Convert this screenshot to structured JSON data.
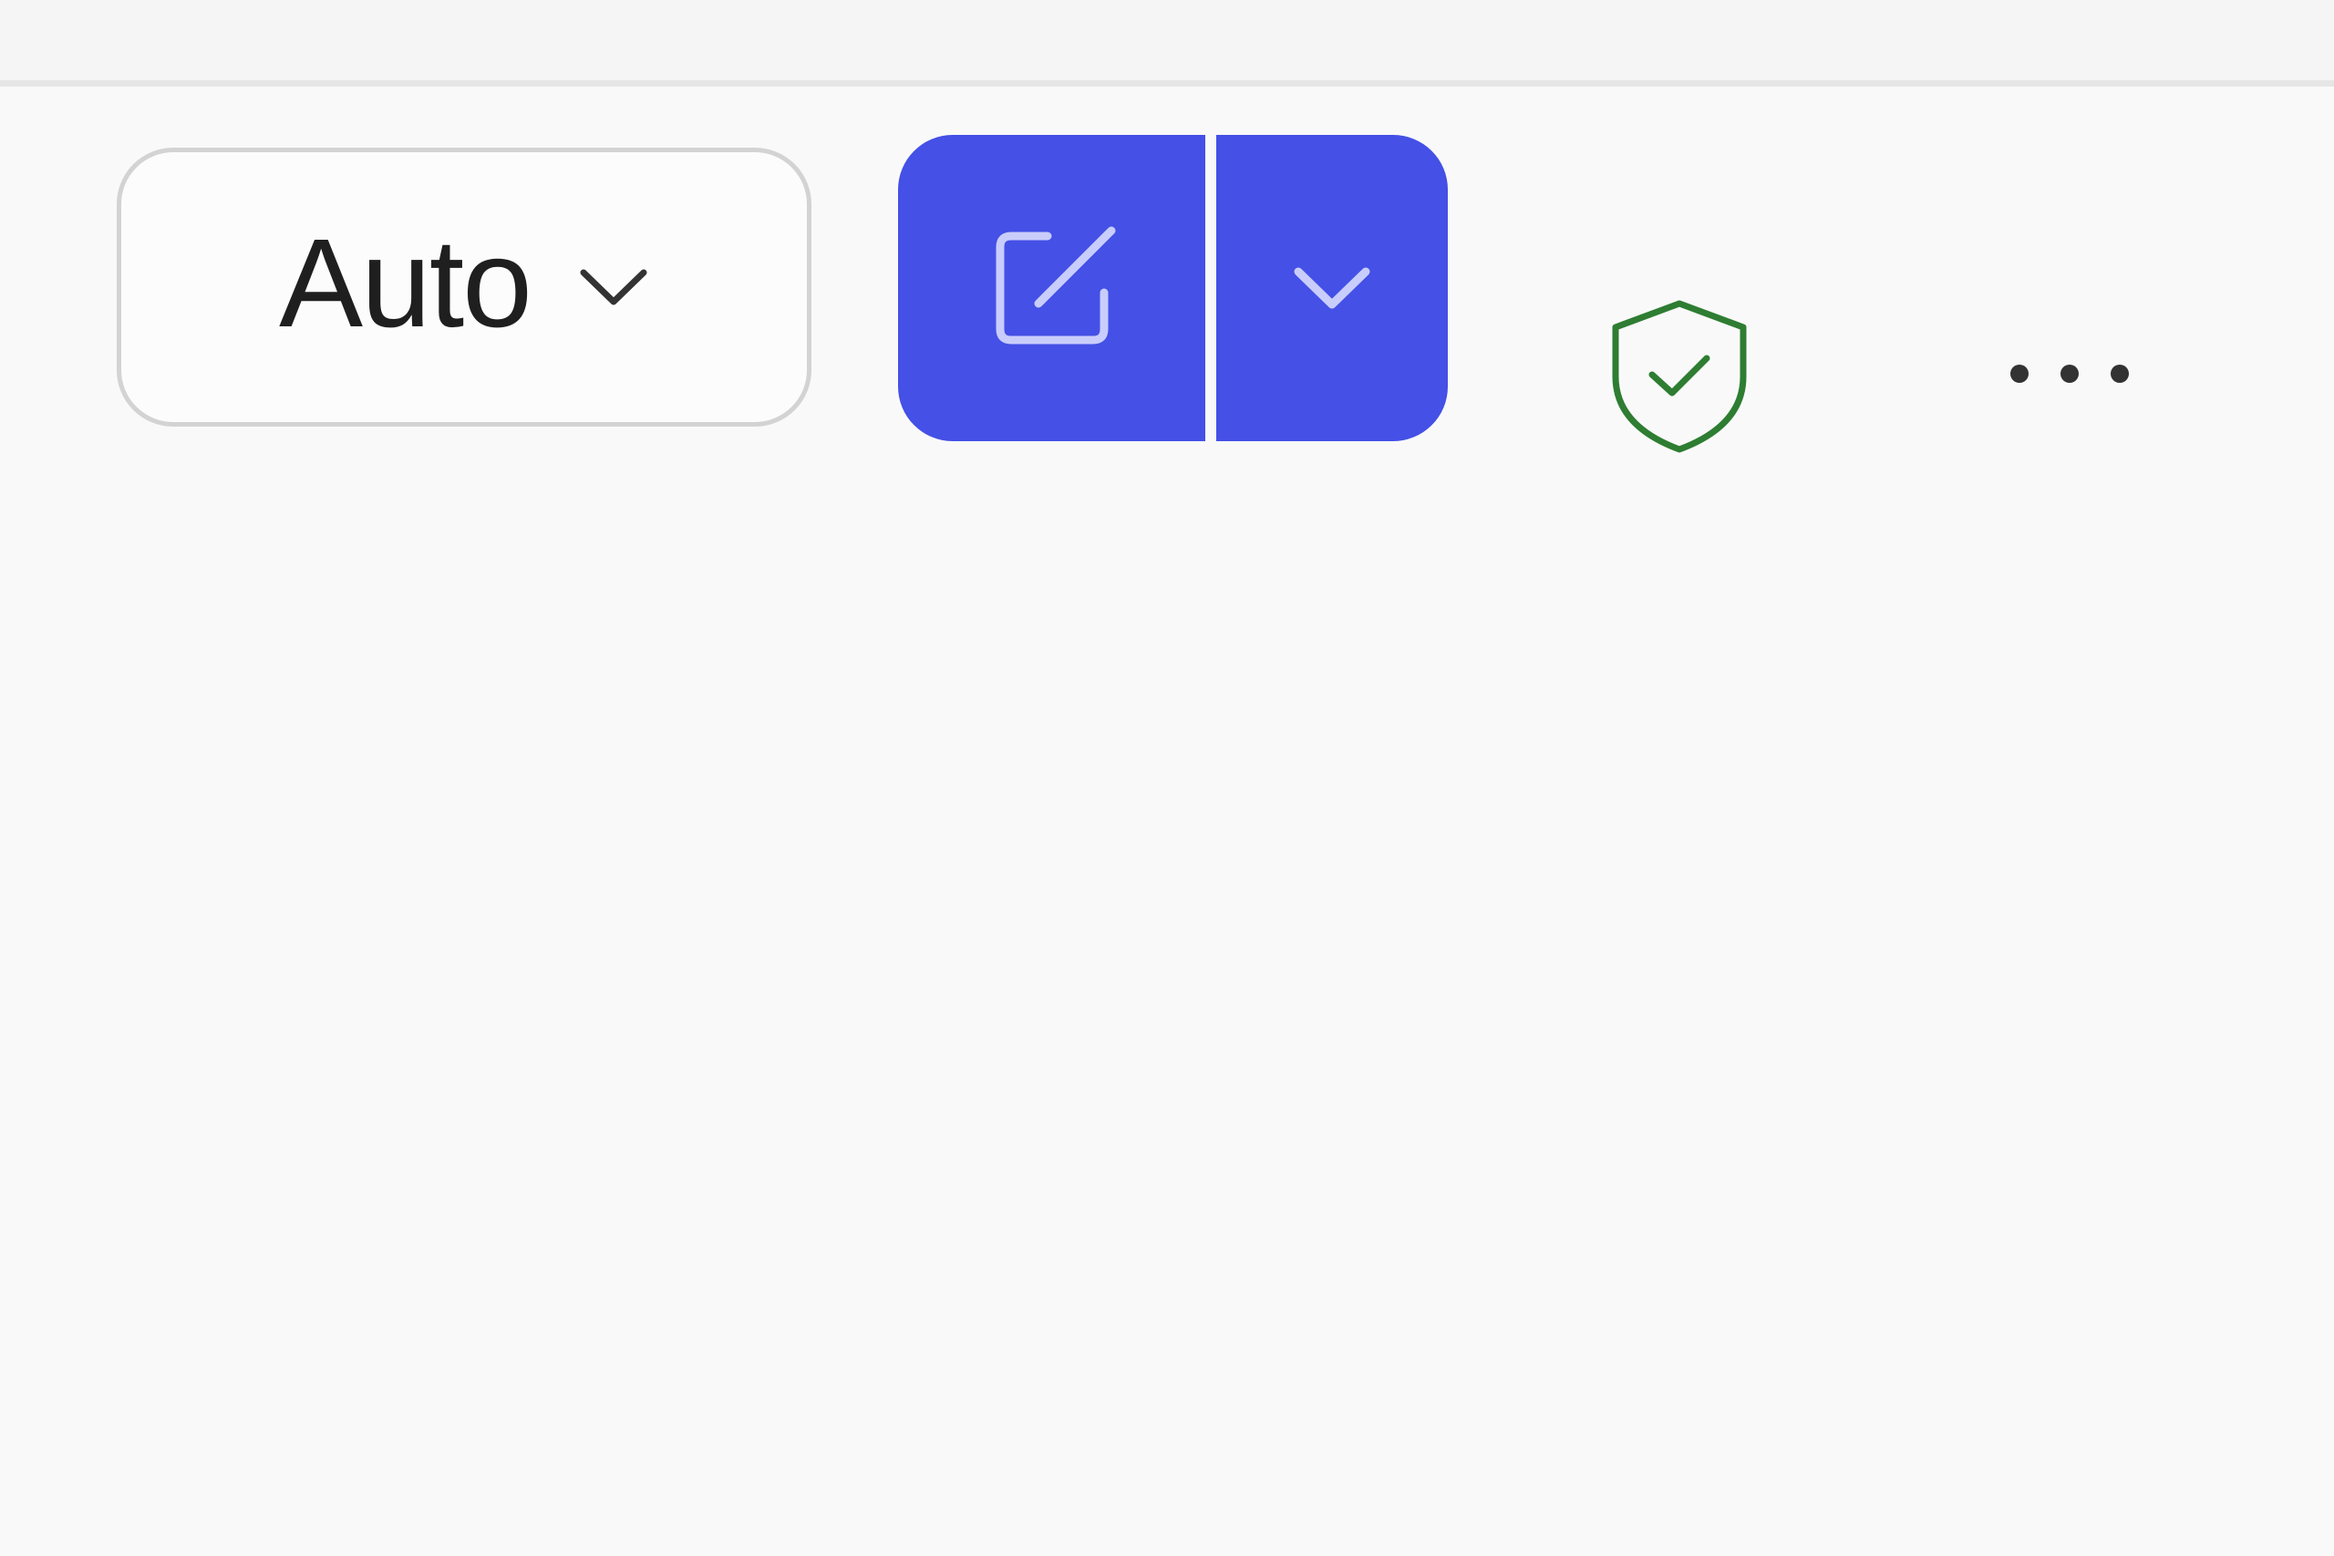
{
  "toolbar": {
    "mode_select": {
      "value": "Auto",
      "icon": "chevron-down-icon"
    },
    "compose_split_button": {
      "main_icon": "compose-icon",
      "arrow_icon": "chevron-down-icon",
      "color": "#4450e6"
    },
    "security_status": {
      "icon": "shield-check-icon",
      "color": "#2e7d32"
    },
    "more_menu": {
      "icon": "more-horizontal-icon"
    }
  }
}
